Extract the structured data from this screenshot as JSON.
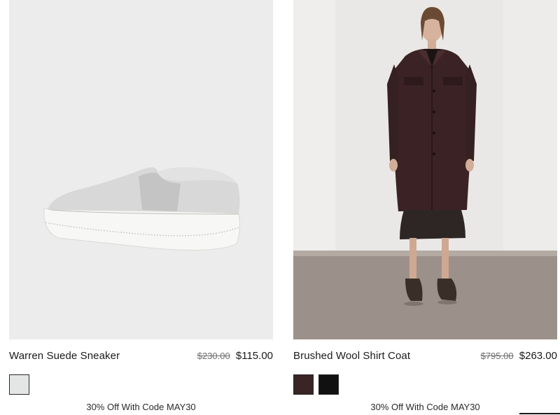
{
  "products": [
    {
      "name": "Warren Suede Sneaker",
      "original_price": "$230.00",
      "sale_price": "$115.00",
      "image_icon": "sneaker-image",
      "swatches": [
        {
          "color": "#e4e6e6",
          "name": "light-grey"
        }
      ],
      "promo": "30% Off With Code MAY30"
    },
    {
      "name": "Brushed Wool Shirt Coat",
      "original_price": "$795.00",
      "sale_price": "$263.00",
      "image_icon": "coat-model-image",
      "swatches": [
        {
          "color": "#3a2424",
          "name": "burgundy"
        },
        {
          "color": "#111111",
          "name": "black"
        }
      ],
      "promo": "30% Off With Code MAY30"
    }
  ],
  "colors": {
    "sneaker_bg": "#ececec",
    "coat_bg_wall": "#e9e8e6",
    "coat_bg_floor": "#9c918a",
    "coat_color": "#3b2325"
  }
}
